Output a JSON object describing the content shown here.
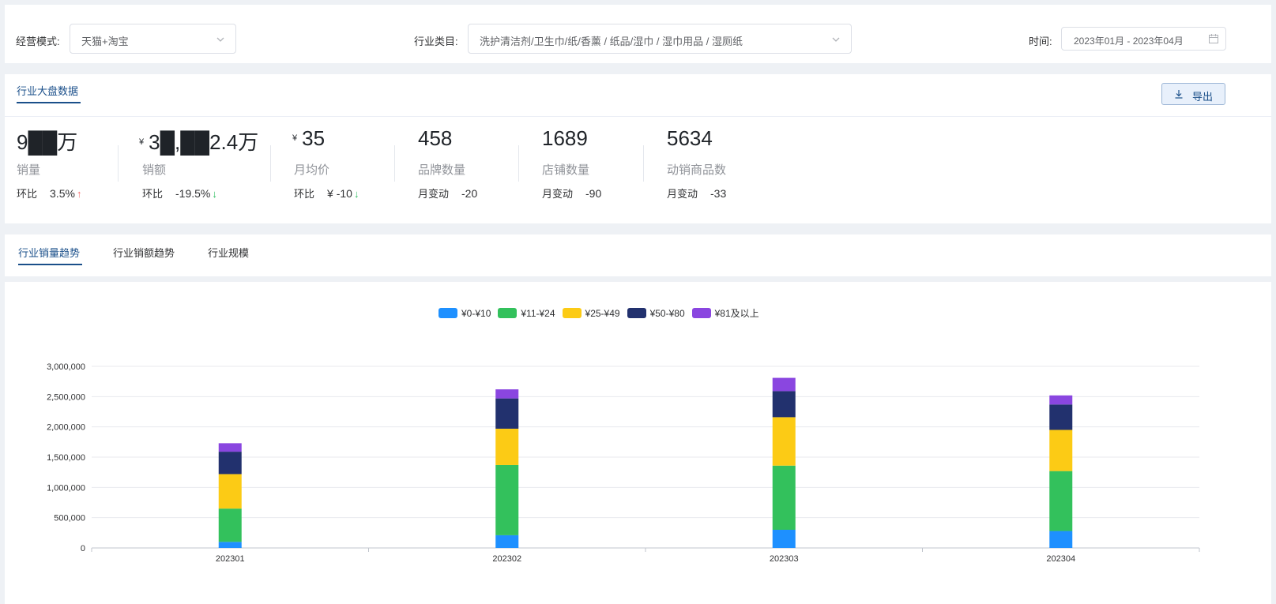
{
  "filters": {
    "mode_label": "经营模式:",
    "mode_value": "天猫+淘宝",
    "category_label": "行业类目:",
    "category_value": "洗护清洁剂/卫生巾/纸/香薰 / 纸品/湿巾 / 湿巾用品 / 湿厕纸",
    "time_label": "时间:",
    "time_value": "2023年01月 - 2023年04月"
  },
  "stats": {
    "tab_label": "行业大盘数据",
    "export_label": "导出",
    "metrics": [
      {
        "value": "9██万",
        "name": "销量",
        "change_label": "环比",
        "change_value": "3.5%",
        "direction": "up"
      },
      {
        "yen": "¥",
        "value": "3█,██2.4万",
        "name": "销额",
        "change_label": "环比",
        "change_value": "-19.5%",
        "direction": "down"
      },
      {
        "yen": "¥",
        "value": "35",
        "name": "月均价",
        "change_label": "环比",
        "change_value": "¥ -10",
        "direction": "down"
      },
      {
        "value": "458",
        "name": "品牌数量",
        "change_label": "月变动",
        "change_value": "-20",
        "direction": "none"
      },
      {
        "value": "1689",
        "name": "店铺数量",
        "change_label": "月变动",
        "change_value": "-90",
        "direction": "none"
      },
      {
        "value": "5634",
        "name": "动销商品数",
        "change_label": "月变动",
        "change_value": "-33",
        "direction": "none"
      }
    ]
  },
  "trend_tabs": [
    "行业销量趋势",
    "行业销额趋势",
    "行业规模"
  ],
  "chart_data": {
    "type": "bar",
    "stacked": true,
    "categories": [
      "202301",
      "202302",
      "202303",
      "202304"
    ],
    "series": [
      {
        "name": "¥0-¥10",
        "color": "#1e90ff",
        "values": [
          100000,
          210000,
          300000,
          280000
        ]
      },
      {
        "name": "¥11-¥24",
        "color": "#33c15c",
        "values": [
          550000,
          1160000,
          1060000,
          990000
        ]
      },
      {
        "name": "¥25-¥49",
        "color": "#fccb15",
        "values": [
          570000,
          600000,
          800000,
          680000
        ]
      },
      {
        "name": "¥50-¥80",
        "color": "#22316e",
        "values": [
          370000,
          500000,
          430000,
          420000
        ]
      },
      {
        "name": "¥81及以上",
        "color": "#8a46e0",
        "values": [
          140000,
          150000,
          220000,
          150000
        ]
      }
    ],
    "ylim": [
      0,
      3000000
    ],
    "yticks": [
      0,
      500000,
      1000000,
      1500000,
      2000000,
      2500000,
      3000000
    ],
    "ytick_labels": [
      "0",
      "500,000",
      "1,000,000",
      "1,500,000",
      "2,000,000",
      "2,500,000",
      "3,000,000"
    ],
    "grid": true,
    "legend_position": "top-center"
  }
}
